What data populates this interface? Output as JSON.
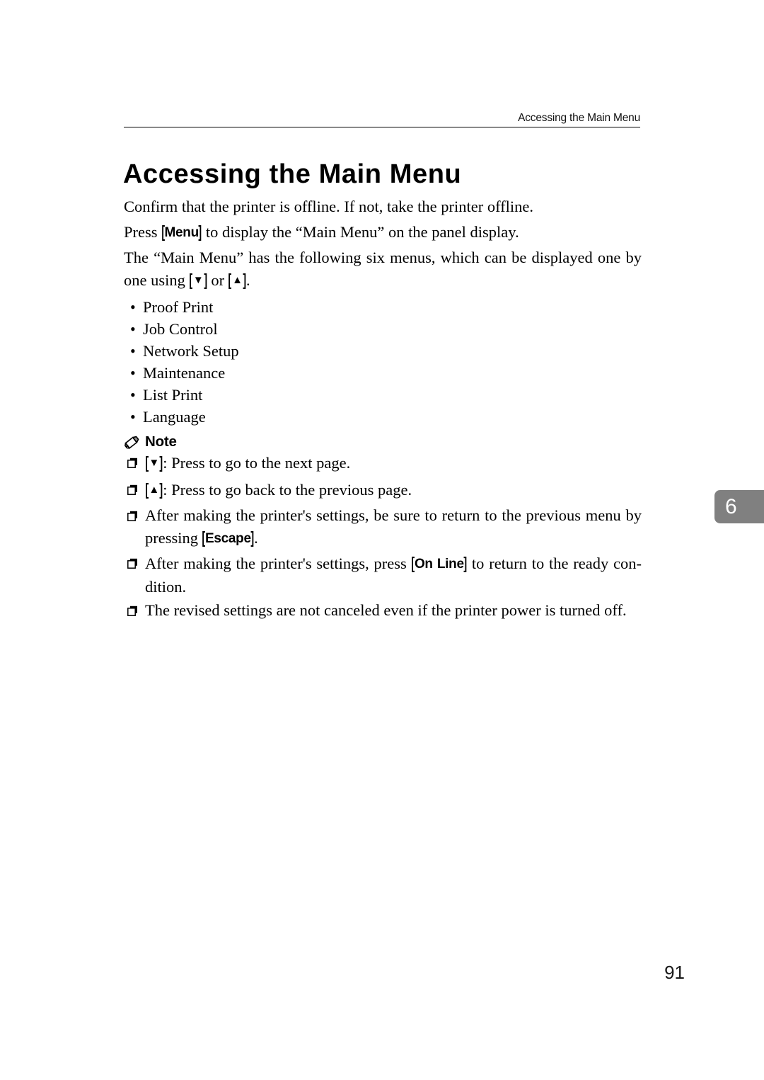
{
  "header": {
    "running_title": "Accessing the Main Menu"
  },
  "title": "Accessing the Main Menu",
  "intro": {
    "line1": "Confirm that the printer is offline. If not, take the printer offline.",
    "line2_before": "Press",
    "line2_key": "Menu",
    "line2_after": "to display the “Main Menu” on the panel display.",
    "line3_before": "The “Main Menu” has the following six menus, which can be displayed one by one using",
    "line3_key_down": "▼",
    "line3_middle": "or",
    "line3_key_up": "▲",
    "line3_after": "."
  },
  "menu_list": {
    "bullet": "•",
    "items": [
      "Proof Print",
      "Job Control",
      "Network Setup",
      "Maintenance",
      "List Print",
      "Language"
    ]
  },
  "note": {
    "label": "Note",
    "icon": "pencil-icon",
    "items": [
      {
        "key": "▼",
        "text": ": Press to go to the next page."
      },
      {
        "key": "▲",
        "text": ": Press to go back to the previous page."
      }
    ],
    "item3_before": "After making the printer's settings, be sure to return to the previous menu by pressing",
    "item3_key": "Escape",
    "item3_after": ".",
    "item4_before": "After making the printer's settings, press",
    "item4_key": "On Line",
    "item4_after": "to return to the ready con-dition.",
    "item5": "The revised settings are not canceled even if the printer power is turned off."
  },
  "chapter_tab": {
    "number": "6"
  },
  "folio": {
    "page_number": "91"
  },
  "colors": {
    "tab_background": "#808080",
    "tab_text": "#ffffff",
    "text": "#000000"
  }
}
